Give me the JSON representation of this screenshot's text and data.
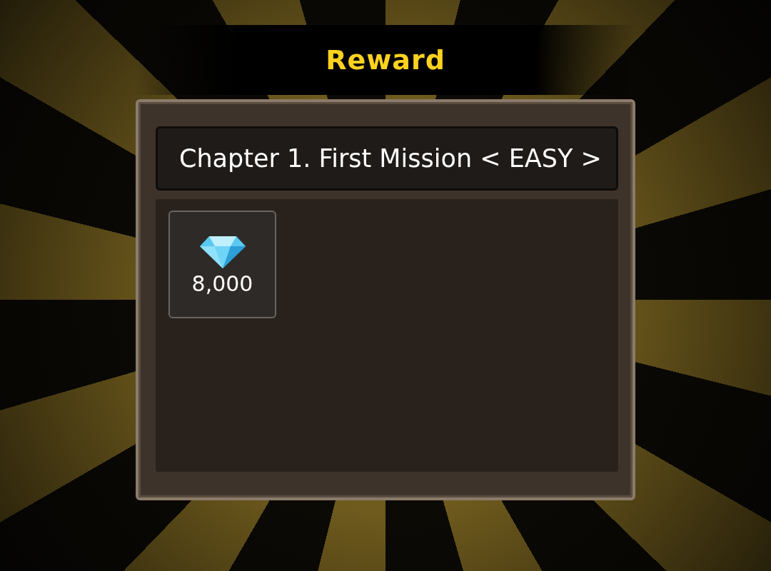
{
  "title": "Reward",
  "header": "Chapter 1. First Mission < EASY >",
  "rewards": [
    {
      "amount": "8,000"
    }
  ]
}
